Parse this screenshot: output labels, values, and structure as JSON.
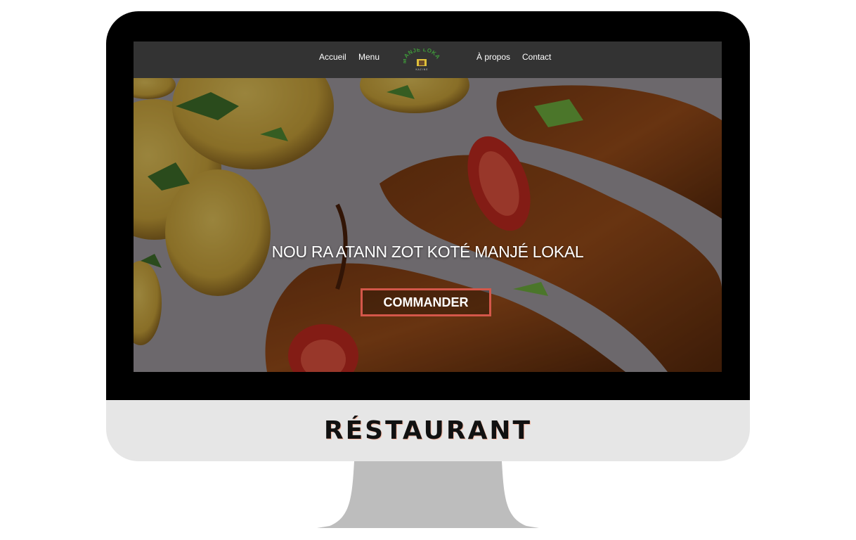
{
  "website": {
    "nav": {
      "items": [
        {
          "label": "Accueil"
        },
        {
          "label": "Menu"
        },
        {
          "label": "À propos"
        },
        {
          "label": "Contact"
        }
      ],
      "logo": {
        "text": "MANJÉ LOKAL",
        "subtext": "K A Z I N E"
      }
    },
    "hero": {
      "headline": "NOU RA ATANN ZOT KOTÉ MANJÉ LOKAL",
      "cta_label": "COMMANDER"
    }
  },
  "caption": "RÉSTAURANT",
  "colors": {
    "nav_bg": "#333333",
    "cta_border": "#d4574a",
    "logo_green": "#3f9a3a",
    "monitor_frame": "#000000",
    "monitor_chin": "#e6e6e6",
    "stand": "#bdbdbd"
  }
}
